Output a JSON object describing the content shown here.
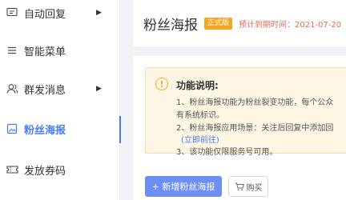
{
  "sidebar": {
    "items": [
      {
        "label": "自动回复",
        "icon": "message-reply-icon",
        "has_arrow": true
      },
      {
        "label": "智能菜单",
        "icon": "menu-list-icon",
        "has_arrow": false
      },
      {
        "label": "群发消息",
        "icon": "users-icon",
        "has_arrow": true
      },
      {
        "label": "粉丝海报",
        "icon": "poster-image-icon",
        "has_arrow": false,
        "active": true
      },
      {
        "label": "发放券码",
        "icon": "coupon-icon",
        "has_arrow": false
      }
    ],
    "arrow_glyph": "▶"
  },
  "header": {
    "title": "粉丝海报",
    "badge": "正式版",
    "expire_text": "预计到期时间：2021-07-20"
  },
  "notice": {
    "icon_glyph": "!",
    "title": "功能说明:",
    "line1": "1、粉丝海报功能为粉丝裂变功能，每个公众",
    "line2": "有系统标识。",
    "line3": "2、粉丝海报应用场景：关注后回复中添加回",
    "line4_link": "(立即前往)",
    "line5": "3、该功能仅限服务号可用。"
  },
  "actions": {
    "add_label": "+ 新增粉丝海报",
    "buy_label": "购买"
  },
  "colors": {
    "accent": "#4a7cf7",
    "badge": "#f5a623",
    "expire": "#e56b5a",
    "notice_bg": "#fdf6e4"
  }
}
